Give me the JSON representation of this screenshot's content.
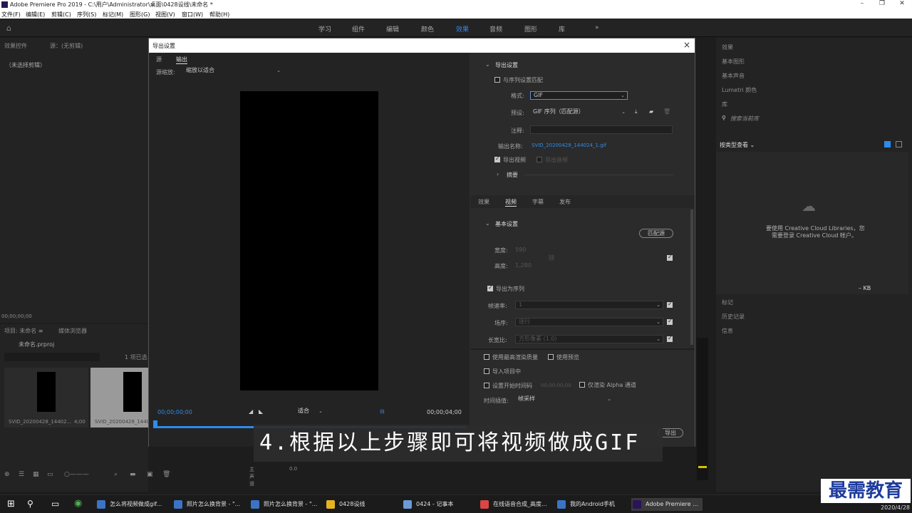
{
  "window": {
    "title": "Adobe Premiere Pro 2019 - C:\\用户\\Administrator\\桌面\\0428设线\\未命名 *"
  },
  "menu": [
    "文件(F)",
    "编辑(E)",
    "剪辑(C)",
    "序列(S)",
    "标记(M)",
    "图形(G)",
    "视图(V)",
    "窗口(W)",
    "帮助(H)"
  ],
  "workspaces": [
    "学习",
    "组件",
    "编辑",
    "颜色",
    "效果",
    "音频",
    "图形",
    "库",
    "»"
  ],
  "left_panel": {
    "tabs": [
      "效果控件",
      "源：(无剪辑)"
    ],
    "empty_text": "（未选择剪辑）",
    "timecode": "00;00;00;00"
  },
  "project": {
    "tabs": [
      "项目: 未命名 ≡",
      "媒体浏览器"
    ],
    "file": "未命名.prproj",
    "selected": "1 项已选",
    "clips": [
      {
        "name": "SVID_20200428_14402...",
        "dur": "4;00"
      },
      {
        "name": "SVID_20200428_14402",
        "dur": ""
      }
    ]
  },
  "right_panel": {
    "items": [
      "效果",
      "基本图形",
      "基本声音",
      "Lumetri 颜色",
      "库"
    ],
    "search_placeholder": "搜索当前库",
    "view_label": "按类型查看 ⌄",
    "cc_msg1": "要使用 Creative Cloud Libraries，您",
    "cc_msg2": "需要登录 Creative Cloud 帐户。",
    "kb": "– KB",
    "bottom_items": [
      "标记",
      "历史记录",
      "信息"
    ]
  },
  "dialog": {
    "title": "导出设置",
    "close": "×",
    "tabs": [
      "源",
      "输出"
    ],
    "source_scale_label": "源缩放:",
    "source_scale_value": "缩放以适合",
    "timecode_start": "00;00;00;00",
    "timecode_end": "00;00;04;00",
    "fit_label": "适合",
    "export_settings": {
      "heading": "导出设置",
      "match_sequence": "与序列设置匹配",
      "format_label": "格式:",
      "format_value": "GIF",
      "preset_label": "预设:",
      "preset_value": "GIF 序列（匹配源）",
      "comment_label": "注释:",
      "output_name_label": "输出名称:",
      "output_name_value": "SVID_20200428_144024_1.gif",
      "export_video": "导出视频",
      "export_audio": "导出音频",
      "summary": "摘要"
    },
    "sub_tabs": [
      "效果",
      "视频",
      "字幕",
      "发布"
    ],
    "basic": {
      "heading": "基本设置",
      "match_source_btn": "匹配源",
      "width_label": "宽度:",
      "width_value": "590",
      "height_label": "高度:",
      "height_value": "1,280",
      "export_as_sequence": "导出为序列",
      "frame_rate_label": "帧速率:",
      "frame_rate_value": "1",
      "field_order_label": "场序:",
      "field_order_value": "逐行",
      "aspect_label": "长宽比:",
      "aspect_value": "方形像素 (1.0)"
    },
    "options": {
      "max_quality": "使用最高渲染质量",
      "use_previews": "使用预览",
      "import_project": "导入项目中",
      "set_start_tc": "设置开始时间码",
      "start_tc_value": "00;00;00;00",
      "alpha_only": "仅渲染 Alpha 通道",
      "interp_label": "时间插值:",
      "interp_value": "帧采样"
    },
    "export_btn": "导出"
  },
  "timeline": {
    "track_label": "主声道",
    "track_value": "0.0"
  },
  "caption": "4.根据以上步骤即可将视频做成GIF",
  "watermark": "最需教育",
  "taskbar": {
    "items": [
      "怎么将视频做成gif...",
      "照片怎么换背景 - \"...",
      "照片怎么换背景 - \"...",
      "0428设线",
      "0424 - 记事本",
      "在线语音合成_高度...",
      "我的Android手机",
      "Adobe Premiere ..."
    ],
    "tray": "英",
    "date": "2020/4/28"
  }
}
